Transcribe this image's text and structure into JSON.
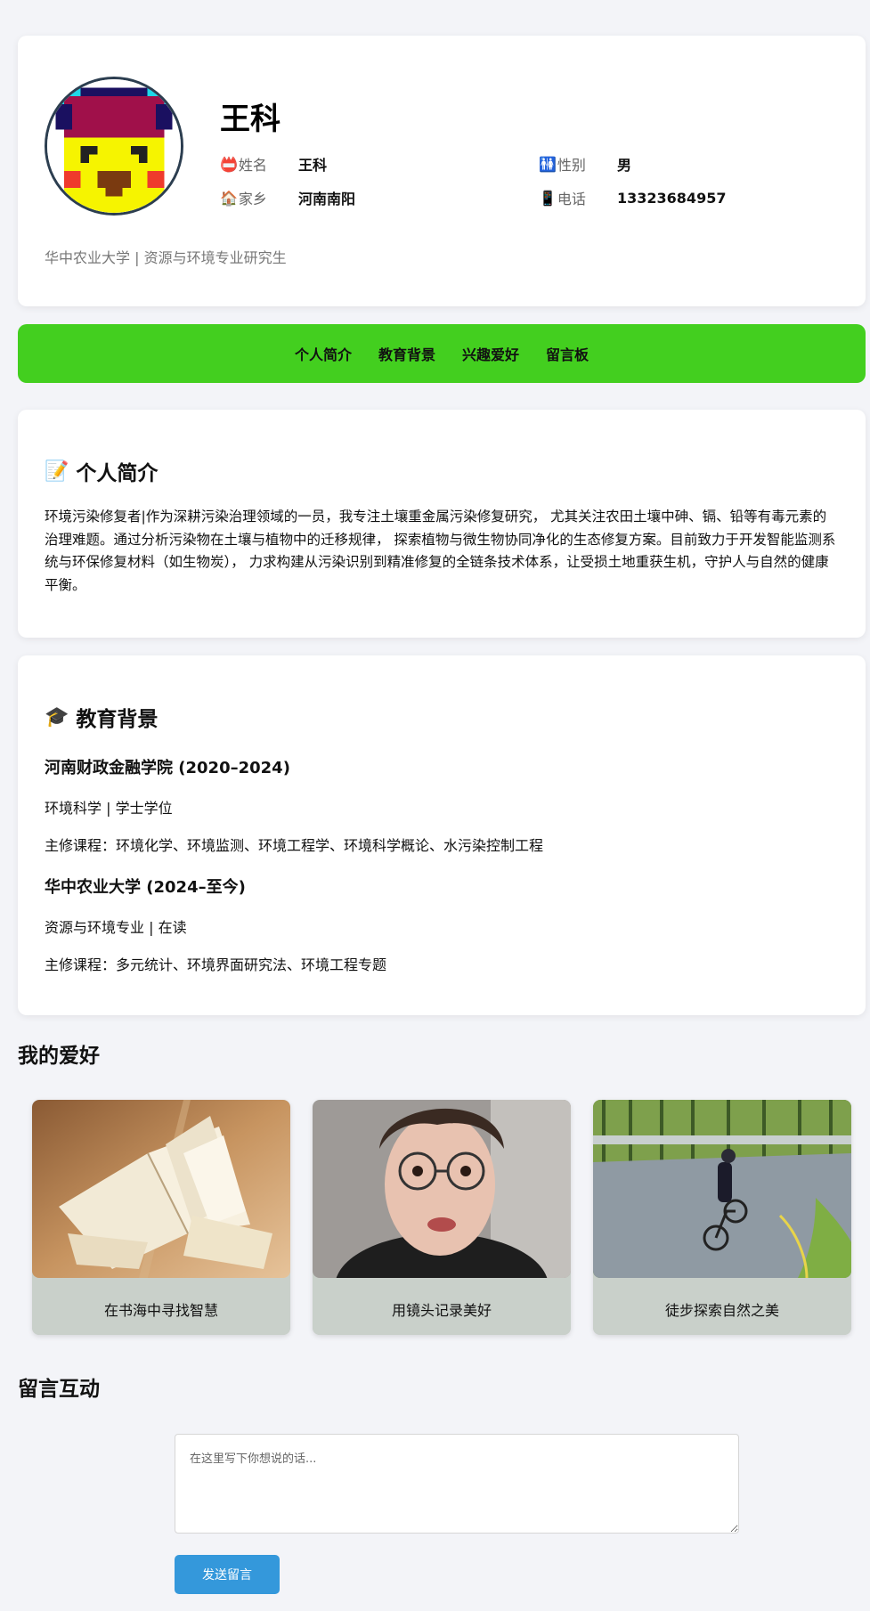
{
  "profile": {
    "name": "王科",
    "fields": [
      {
        "icon": "📛",
        "label": "姓名",
        "value": "王科"
      },
      {
        "icon": "🚻",
        "label": "性别",
        "value": "男"
      },
      {
        "icon": "🏠",
        "label": "家乡",
        "value": "河南南阳"
      },
      {
        "icon": "📱",
        "label": "电话",
        "value": "13323684957"
      }
    ],
    "subtitle": "华中农业大学 | 资源与环境专业研究生"
  },
  "nav": {
    "items": [
      "个人简介",
      "教育背景",
      "兴趣爱好",
      "留言板"
    ],
    "color": "#43cf1f"
  },
  "intro": {
    "icon": "📝",
    "title": "个人简介",
    "text": "环境污染修复者|作为深耕污染治理领域的一员，我专注土壤重金属污染修复研究， 尤其关注农田土壤中砷、镉、铅等有毒元素的治理难题。通过分析污染物在土壤与植物中的迁移规律， 探索植物与微生物协同净化的生态修复方案。目前致力于开发智能监测系统与环保修复材料（如生物炭）， 力求构建从污染识别到精准修复的全链条技术体系，让受损土地重获生机，守护人与自然的健康平衡。"
  },
  "education": {
    "icon": "🎓",
    "title": "教育背景",
    "schools": [
      {
        "name": "河南财政金融学院 (2020–2024)",
        "degree": "环境科学 | 学士学位",
        "courses": "主修课程：环境化学、环境监测、环境工程学、环境科学概论、水污染控制工程"
      },
      {
        "name": "华中农业大学 (2024–至今)",
        "degree": "资源与环境专业 | 在读",
        "courses": "主修课程：多元统计、环境界面研究法、环境工程专题"
      }
    ]
  },
  "hobbies": {
    "title": "我的爱好",
    "items": [
      {
        "caption": "在书海中寻找智慧",
        "image": "open-book-photo"
      },
      {
        "caption": "用镜头记录美好",
        "image": "portrait-photo"
      },
      {
        "caption": "徒步探索自然之美",
        "image": "cycling-photo"
      }
    ]
  },
  "message": {
    "title": "留言互动",
    "placeholder": "在这里写下你想说的话...",
    "send_label": "发送留言",
    "button_color": "#3498db"
  }
}
